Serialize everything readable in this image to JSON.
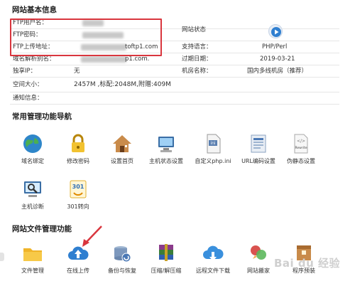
{
  "sections": {
    "basic_info": "网站基本信息",
    "nav": "常用管理功能导航",
    "files": "网站文件管理功能"
  },
  "info": {
    "ftp_user_label": "FTP用户名：",
    "ftp_pass_label": "FTP密码：",
    "ftp_host_label": "FTP上传地址：",
    "ftp_host_value": "toftp1.com",
    "domain_label": "域名解析别名：",
    "domain_value": "p1.com.",
    "ip_label": "独享IP：",
    "ip_value": "无",
    "space_label": "空间大小：",
    "space_value": "2457M ,标配:2048M,附赠:409M",
    "notice_label": "通知信息：",
    "status_label": "网站状态",
    "lang_label": "支持语言：",
    "lang_value": "PHP/Perl",
    "expire_label": "过期日期：",
    "expire_value": "2019-03-21",
    "room_label": "机房名称：",
    "room_value": "国内多线机房（推荐）"
  },
  "nav_items": [
    {
      "label": "域名绑定",
      "icon": "globe-icon"
    },
    {
      "label": "修改密码",
      "icon": "lock-icon"
    },
    {
      "label": "设置首页",
      "icon": "house-icon"
    },
    {
      "label": "主机状态设置",
      "icon": "computer-icon"
    },
    {
      "label": "自定义php.ini",
      "icon": "ini-file-icon"
    },
    {
      "label": "URL编码设置",
      "icon": "url-doc-icon"
    },
    {
      "label": "伪静态设置",
      "icon": "rewrite-icon"
    },
    {
      "label": "主机诊断",
      "icon": "diagnose-icon"
    },
    {
      "label": "301转向",
      "icon": "redirect-301-icon"
    }
  ],
  "file_items": [
    {
      "label": "文件管理",
      "icon": "folder-icon"
    },
    {
      "label": "在线上传",
      "icon": "cloud-upload-icon"
    },
    {
      "label": "备份与恢复",
      "icon": "backup-icon"
    },
    {
      "label": "压缩/解压缩",
      "icon": "archive-icon"
    },
    {
      "label": "远程文件下载",
      "icon": "cloud-download-icon"
    },
    {
      "label": "网站搬家",
      "icon": "move-site-icon"
    },
    {
      "label": "程序预装",
      "icon": "preinstall-icon"
    }
  ],
  "watermark": "Bai du 经验",
  "colors": {
    "highlight": "#d9363e",
    "arrow": "#d9363e",
    "link": "#1a5fb4"
  }
}
